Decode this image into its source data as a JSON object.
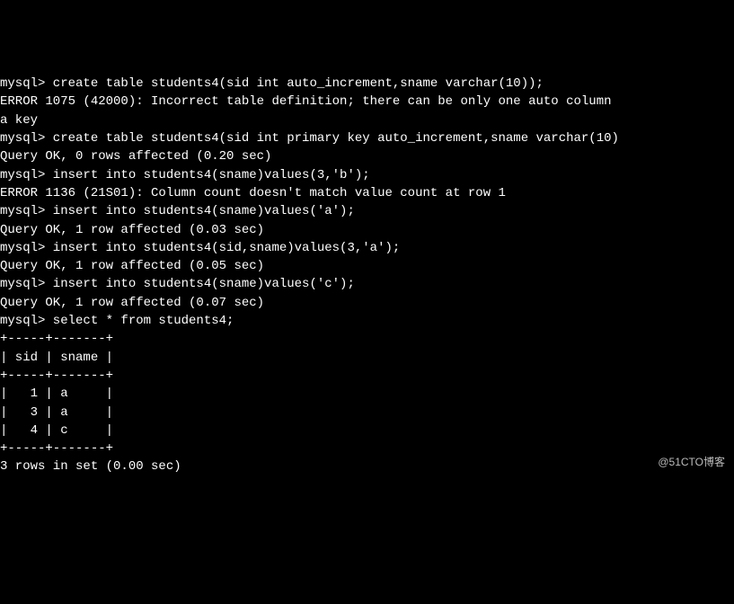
{
  "terminal": {
    "lines": [
      "mysql> create table students4(sid int auto_increment,sname varchar(10));",
      "ERROR 1075 (42000): Incorrect table definition; there can be only one auto column",
      "a key",
      "mysql> create table students4(sid int primary key auto_increment,sname varchar(10)",
      "Query OK, 0 rows affected (0.20 sec)",
      "",
      "mysql> insert into students4(sname)values(3,'b');",
      "ERROR 1136 (21S01): Column count doesn't match value count at row 1",
      "mysql> insert into students4(sname)values('a');",
      "Query OK, 1 row affected (0.03 sec)",
      "",
      "mysql> insert into students4(sid,sname)values(3,'a');",
      "Query OK, 1 row affected (0.05 sec)",
      "",
      "mysql> insert into students4(sname)values('c');",
      "Query OK, 1 row affected (0.07 sec)",
      "",
      "mysql> select * from students4;",
      "+-----+-------+",
      "| sid | sname |",
      "+-----+-------+",
      "|   1 | a     |",
      "|   3 | a     |",
      "|   4 | c     |",
      "+-----+-------+",
      "3 rows in set (0.00 sec)"
    ]
  },
  "watermark": "@51CTO博客"
}
